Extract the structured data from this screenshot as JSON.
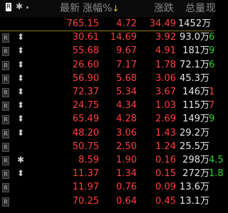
{
  "header": {
    "flag_label": "R",
    "star": "✱",
    "col_latest": "最新",
    "col_pct": "涨幅%",
    "sort_arrow": "↓",
    "col_change": "涨跌",
    "col_volume": "总量",
    "col_cut": "现"
  },
  "colors": {
    "up": "#ff3f3f",
    "green": "#2fd12f",
    "accent_divider": "#8b7d00",
    "background": "#000000"
  },
  "rows": [
    {
      "flag": "",
      "mark": "",
      "price": "765.15",
      "pct": "4.72",
      "chg": "34.49",
      "vol": "1452万",
      "cut": "",
      "cut_color": "red"
    },
    {
      "flag": "R",
      "mark": "⬍",
      "price": "30.61",
      "pct": "14.69",
      "chg": "3.92",
      "vol": "93.0万",
      "cut": "6",
      "cut_color": "green"
    },
    {
      "flag": "R",
      "mark": "⬍",
      "price": "55.68",
      "pct": "9.67",
      "chg": "4.91",
      "vol": "181万",
      "cut": "9",
      "cut_color": "green"
    },
    {
      "flag": "R",
      "mark": "⬍",
      "price": "26.60",
      "pct": "7.17",
      "chg": "1.78",
      "vol": "72.1万",
      "cut": "6",
      "cut_color": "green"
    },
    {
      "flag": "R",
      "mark": "⬍",
      "price": "56.90",
      "pct": "5.68",
      "chg": "3.06",
      "vol": "45.3万",
      "cut": "",
      "cut_color": "red"
    },
    {
      "flag": "R",
      "mark": "⬍",
      "price": "72.37",
      "pct": "5.34",
      "chg": "3.67",
      "vol": "146万",
      "cut": "1",
      "cut_color": "red"
    },
    {
      "flag": "R",
      "mark": "⬍",
      "price": "24.75",
      "pct": "4.34",
      "chg": "1.03",
      "vol": "115万",
      "cut": "7",
      "cut_color": "red"
    },
    {
      "flag": "R",
      "mark": "⬍",
      "price": "65.49",
      "pct": "4.28",
      "chg": "2.69",
      "vol": "149万",
      "cut": "9",
      "cut_color": "green"
    },
    {
      "flag": "R",
      "mark": "⬍",
      "price": "48.20",
      "pct": "3.06",
      "chg": "1.43",
      "vol": "29.2万",
      "cut": "",
      "cut_color": "red"
    },
    {
      "flag": "R",
      "mark": "",
      "price": "50.75",
      "pct": "2.50",
      "chg": "1.24",
      "vol": "25.5万",
      "cut": "",
      "cut_color": "red"
    },
    {
      "flag": "R",
      "mark": "✱",
      "price": "8.59",
      "pct": "1.90",
      "chg": "0.16",
      "vol": "298万",
      "cut": "4.5",
      "cut_color": "green"
    },
    {
      "flag": "R",
      "mark": "⬍",
      "price": "11.37",
      "pct": "1.34",
      "chg": "0.15",
      "vol": "272万",
      "cut": "1.8",
      "cut_color": "green"
    },
    {
      "flag": "R",
      "mark": "",
      "price": "11.97",
      "pct": "0.76",
      "chg": "0.09",
      "vol": "13.6万",
      "cut": "",
      "cut_color": "red"
    },
    {
      "flag": "R",
      "mark": "",
      "price": "70.25",
      "pct": "0.64",
      "chg": "0.45",
      "vol": "13.1万",
      "cut": "",
      "cut_color": "red"
    }
  ]
}
